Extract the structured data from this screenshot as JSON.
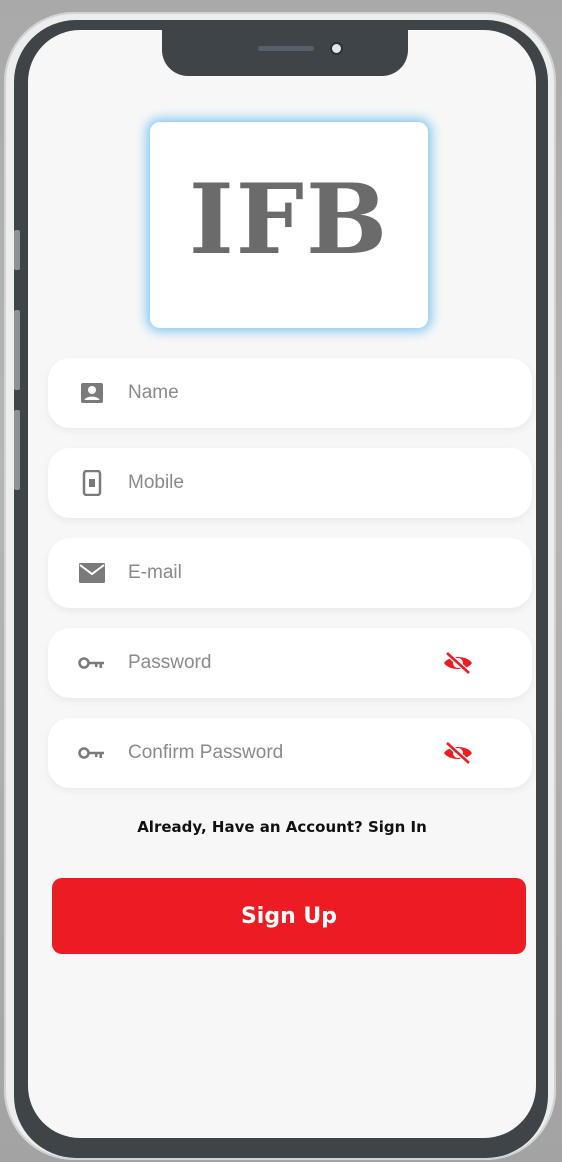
{
  "logo": {
    "text": "IFB"
  },
  "form": {
    "name": {
      "placeholder": "Name",
      "icon": "person-card-icon"
    },
    "mobile": {
      "placeholder": "Mobile",
      "icon": "mobile-phone-icon"
    },
    "email": {
      "placeholder": "E-mail",
      "icon": "mail-icon"
    },
    "password": {
      "placeholder": "Password",
      "icon": "key-icon",
      "toggle_icon": "eye-off-icon"
    },
    "confirm_password": {
      "placeholder": "Confirm Password",
      "icon": "key-icon",
      "toggle_icon": "eye-off-icon"
    }
  },
  "signin": {
    "prompt": "Already, Have an Account?",
    "link": "Sign In"
  },
  "signup": {
    "label": "Sign Up"
  },
  "colors": {
    "accent": "#ed1c24",
    "icon_gray": "#7a7a7a",
    "logo_gray": "#6b6b6b",
    "logo_glow": "#64bef0"
  }
}
